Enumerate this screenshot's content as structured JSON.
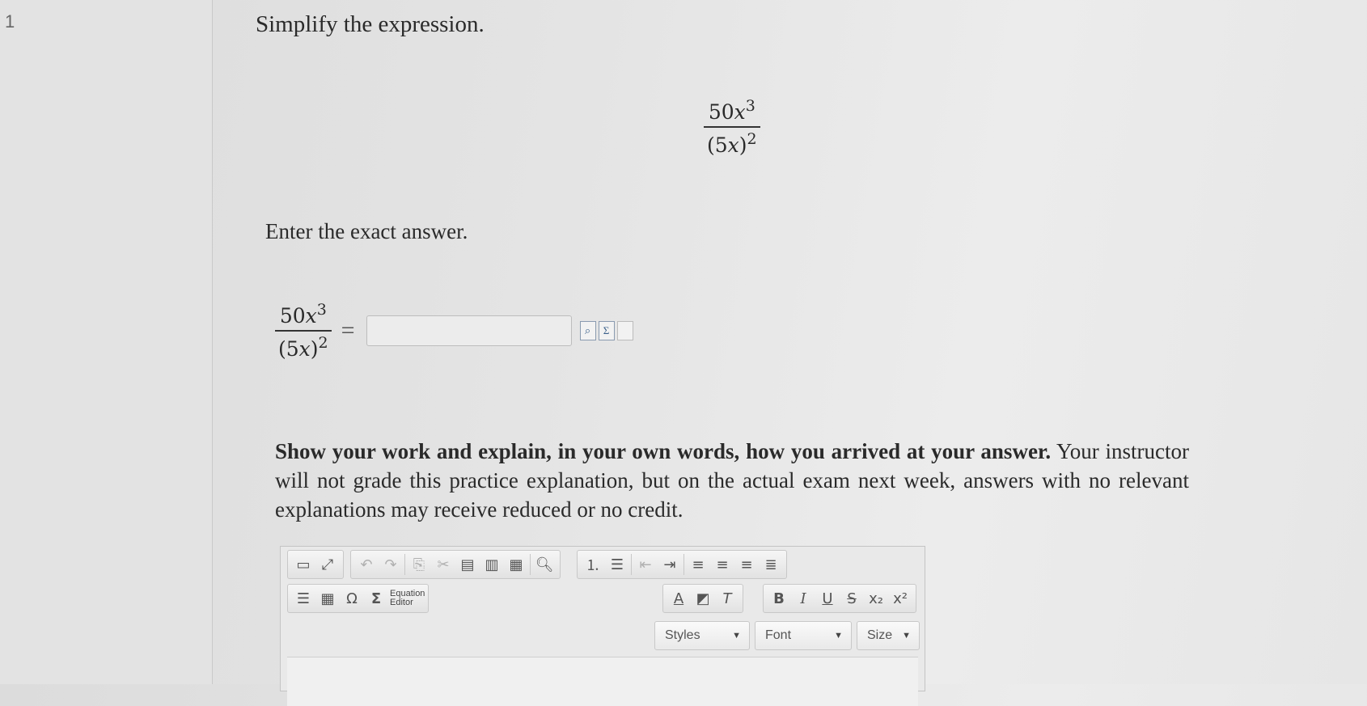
{
  "question": {
    "number": "1",
    "prompt": "Simplify the expression.",
    "expression": {
      "numerator_coef": "50",
      "numerator_var": "x",
      "numerator_exp": "3",
      "denominator_base": "(5",
      "denominator_var": "x",
      "denominator_close": ")",
      "denominator_exp": "2"
    },
    "enter_label": "Enter the exact answer.",
    "equals": "=",
    "answer_value": ""
  },
  "answer_tools": [
    "preview-icon",
    "sigma-doc-icon",
    "blank-doc-icon"
  ],
  "instructions": {
    "bold": "Show your work and explain, in your own words, how you arrived at your answer.",
    "normal": " Your instructor will not grade this practice explanation, but on the actual exam next week, answers with no relevant explanations may receive reduced or no credit."
  },
  "editor": {
    "equation_editor_line1": "Equation",
    "equation_editor_line2": "Editor",
    "styles_label": "Styles",
    "font_label": "Font",
    "size_label": "Size"
  }
}
